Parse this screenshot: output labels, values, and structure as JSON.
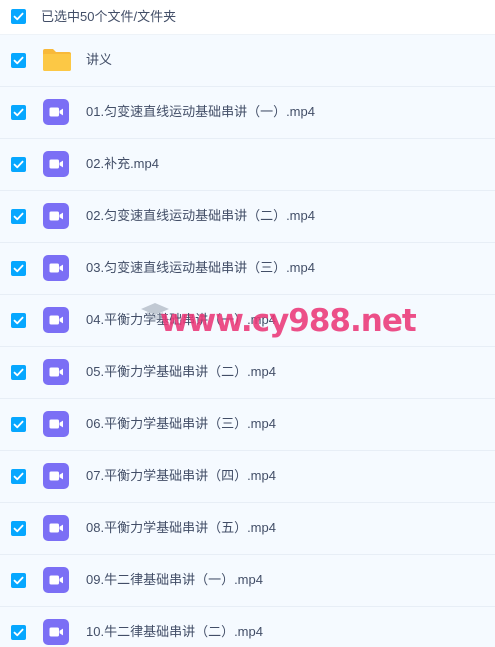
{
  "header": {
    "select_label": "已选中50个文件/文件夹"
  },
  "items": [
    {
      "type": "folder",
      "name": "讲义"
    },
    {
      "type": "video",
      "name": "01.匀变速直线运动基础串讲（一）.mp4"
    },
    {
      "type": "video",
      "name": "02.补充.mp4"
    },
    {
      "type": "video",
      "name": "02.匀变速直线运动基础串讲（二）.mp4"
    },
    {
      "type": "video",
      "name": "03.匀变速直线运动基础串讲（三）.mp4"
    },
    {
      "type": "video",
      "name": "04.平衡力学基础串讲（一）.mp4"
    },
    {
      "type": "video",
      "name": "05.平衡力学基础串讲（二）.mp4"
    },
    {
      "type": "video",
      "name": "06.平衡力学基础串讲（三）.mp4"
    },
    {
      "type": "video",
      "name": "07.平衡力学基础串讲（四）.mp4"
    },
    {
      "type": "video",
      "name": "08.平衡力学基础串讲（五）.mp4"
    },
    {
      "type": "video",
      "name": "09.牛二律基础串讲（一）.mp4"
    },
    {
      "type": "video",
      "name": "10.牛二律基础串讲（二）.mp4"
    }
  ],
  "watermark": {
    "text": "www.cy988.net"
  },
  "colors": {
    "checkbox": "#06a7ff",
    "video_icon": "#7b6ff5",
    "folder_icon": "#fcc845",
    "text": "#424e67",
    "watermark": "#eb3778"
  }
}
